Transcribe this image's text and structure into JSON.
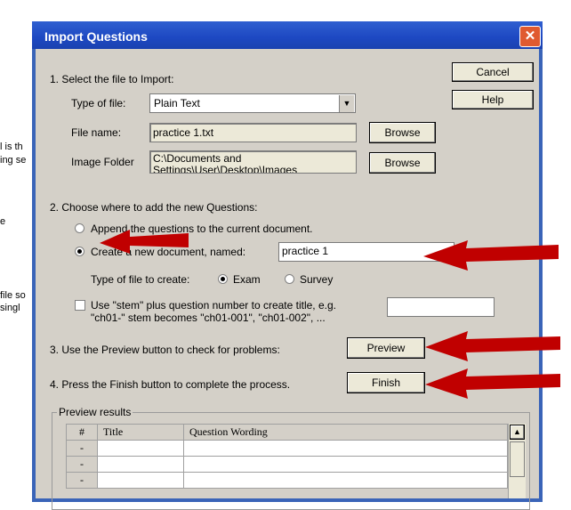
{
  "background_fragments": [
    "l is th",
    "ing se",
    "e",
    "file so",
    "singl"
  ],
  "dialog": {
    "title": "Import Questions",
    "close_glyph": "✕"
  },
  "section1": {
    "heading": "1.  Select the file to Import:",
    "type_label": "Type of file:",
    "type_value": "Plain Text",
    "filename_label": "File name:",
    "filename_value": "practice 1.txt",
    "image_folder_label": "Image Folder",
    "image_folder_value": "C:\\Documents and Settings\\User\\Desktop\\Images",
    "browse_label": "Browse",
    "browse2_label": "Browse"
  },
  "buttons": {
    "cancel": "Cancel",
    "help": "Help"
  },
  "section2": {
    "heading": "2.  Choose where to add the new Questions:",
    "append_label": "Append the questions to the current document.",
    "create_label": "Create a new document, named:",
    "create_value": "practice  1",
    "create_selected": true,
    "filetype_label": "Type of file to create:",
    "exam_label": "Exam",
    "survey_label": "Survey",
    "exam_selected": true,
    "stem_line1": "Use \"stem\" plus question number to create title,  e.g.",
    "stem_line2": "\"ch01-\" stem becomes \"ch01-001\",  \"ch01-002\",  ...",
    "stem_checked": false,
    "stem_value": ""
  },
  "section3": {
    "text": "3.  Use the Preview button to check for problems:",
    "button": "Preview"
  },
  "section4": {
    "text": "4.  Press the Finish button to complete the process.",
    "button": "Finish"
  },
  "preview": {
    "group_label": "Preview results",
    "columns": [
      "#",
      "Title",
      "Question Wording"
    ],
    "rows": [
      [
        "-",
        "",
        ""
      ],
      [
        "-",
        "",
        ""
      ],
      [
        "-",
        "",
        ""
      ]
    ],
    "scroll_up": "▲"
  },
  "annotation_color": "#c00000"
}
